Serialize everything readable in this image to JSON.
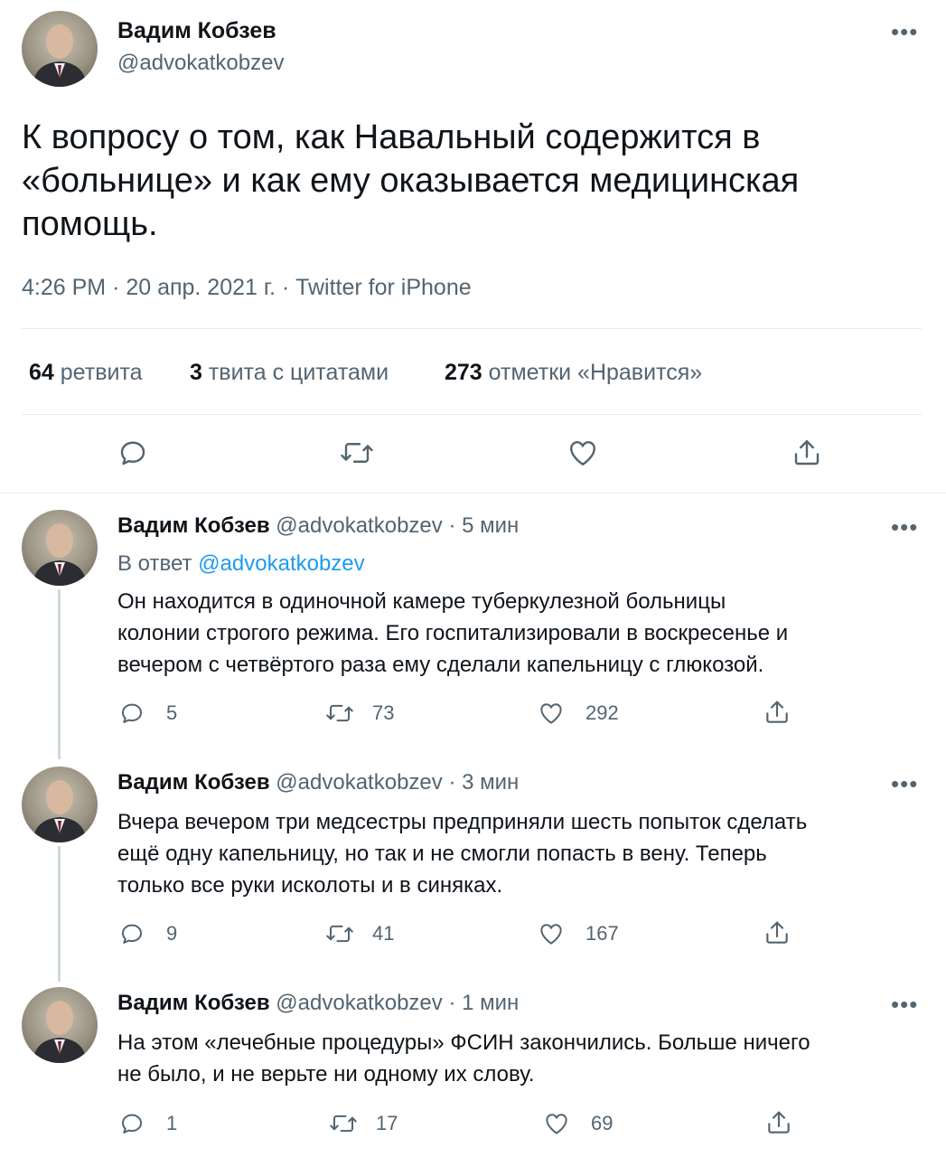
{
  "main_tweet": {
    "author_name": "Вадим Кобзев",
    "author_handle": "@advokatkobzev",
    "more_icon": "more-horizontal-icon",
    "text_line1": "К вопросу о том, как Навальный содержится в",
    "text_line2": "«больнице» и как ему оказывается медицинская",
    "text_line3": "помощь.",
    "meta": "4:26 PM · 20 апр. 2021 г. · Twitter for iPhone",
    "stats": {
      "retweets_count": "64",
      "retweets_label": "ретвита",
      "quotes_count": "3",
      "quotes_label": "твита с цитатами",
      "likes_count": "273",
      "likes_label": "отметки «Нравится»"
    },
    "actions": [
      "reply-icon",
      "retweet-icon",
      "like-icon",
      "share-icon"
    ]
  },
  "replies": [
    {
      "author_name": "Вадим Кобзев",
      "author_handle": "@advokatkobzev",
      "time": "· 5 мин",
      "reply_to_prefix": "В ответ",
      "reply_to_handle": "@advokatkobzev",
      "line1": "Он находится в одиночной камере туберкулезной больницы",
      "line2": "колонии строгого режима. Его госпитализировали в воскресенье и",
      "line3": "вечером с четвёртого раза ему сделали капельницу с глюкозой.",
      "replies_count": "5",
      "retweets_count": "73",
      "likes_count": "292"
    },
    {
      "author_name": "Вадим Кобзев",
      "author_handle": "@advokatkobzev",
      "time": "· 3 мин",
      "line1": "Вчера вечером три медсестры предприняли шесть попыток сделать",
      "line2": "ещё одну капельницу, но так и не смогли попасть в вену. Теперь",
      "line3": "только все руки исколоты и в синяках.",
      "replies_count": "9",
      "retweets_count": "41",
      "likes_count": "167"
    },
    {
      "author_name": "Вадим Кобзев",
      "author_handle": "@advokatkobzev",
      "time": "· 1 мин",
      "line1": "На этом «лечебные процедуры» ФСИН закончились. Больше ничего",
      "line2": "не было, и не верьте ни одному их слову.",
      "replies_count": "1",
      "retweets_count": "17",
      "likes_count": "69"
    }
  ],
  "colors": {
    "text": "#0f1419",
    "secondary": "#536471",
    "link": "#1d9bf0",
    "divider": "#e6ecf0",
    "thread_line": "#cfd9de"
  }
}
